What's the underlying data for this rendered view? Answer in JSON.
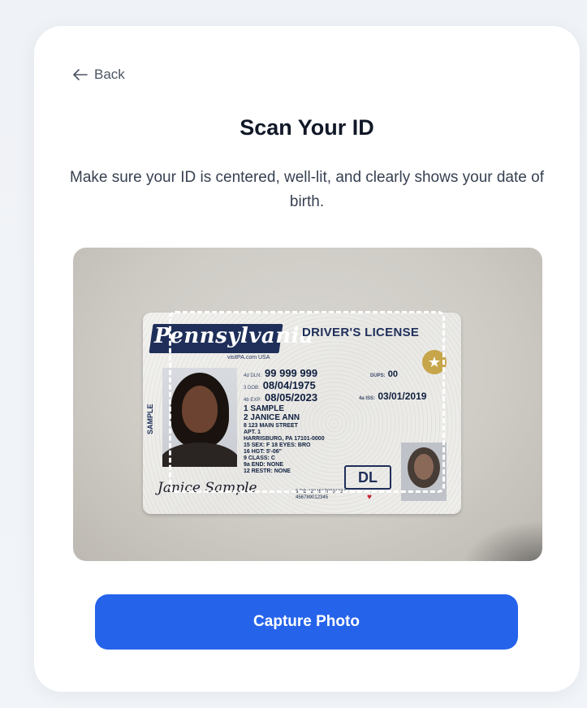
{
  "nav": {
    "back_label": "Back"
  },
  "header": {
    "title": "Scan Your ID",
    "subtitle": "Make sure your ID is centered, well-lit, and clearly shows your date of birth."
  },
  "id_card": {
    "state": "Pennsylvania",
    "state_sub": "visitPA.com   USA",
    "type": "DRIVER'S LICENSE",
    "dln_label": "4d DLN:",
    "dln": "99 999 999",
    "dups_label": "DUPS:",
    "dups": "00",
    "dob_label": "3 DOB:",
    "dob": "08/04/1975",
    "exp_label": "4b EXP:",
    "exp": "08/05/2023",
    "iss_label": "4a ISS:",
    "iss": "03/01/2019",
    "last_name": "1 SAMPLE",
    "first_name": "2 JANICE ANN",
    "address_1": "8 123 MAIN STREET",
    "address_2": "APT. 1",
    "address_3": "HARRISBURG, PA 17101-0000",
    "sex_eyes": "15 SEX: F   18 EYES: BRO",
    "height": "16 HGT: 5'-06\"",
    "class": "9 CLASS: C",
    "endorsements": "9a END: NONE",
    "restrictions": "12 RESTR: NONE",
    "dl_badge": "DL",
    "dd_line_1": "5 DD:12345678901234",
    "dd_line_2": "456789012345",
    "side_text": "SAMPLE",
    "signature": "Janice Sample"
  },
  "actions": {
    "capture_label": "Capture Photo"
  },
  "colors": {
    "accent": "#2563eb",
    "card": "#ffffff",
    "background": "#eef1f5"
  }
}
